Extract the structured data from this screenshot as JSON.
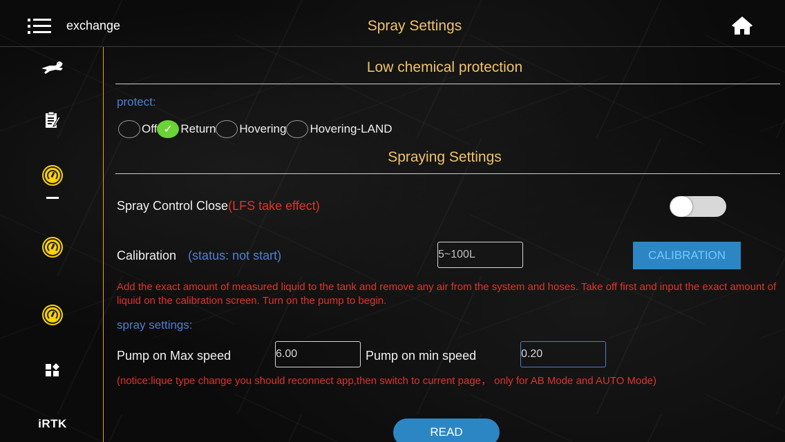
{
  "topbar": {
    "menu_icon": "menu-icon",
    "exchange_label": "exchange",
    "title": "Spray Settings",
    "home_icon": "home-icon"
  },
  "sidebar": {
    "items": [
      {
        "icon": "plane-wrench-icon"
      },
      {
        "icon": "clipboard-edit-icon"
      },
      {
        "icon": "gauge-icon"
      },
      {
        "icon": "dash-icon"
      },
      {
        "icon": "gauge-icon"
      },
      {
        "icon": "gauge-icon"
      },
      {
        "icon": "grid-apps-icon"
      },
      {
        "label": "iRTK"
      }
    ]
  },
  "low_chemical": {
    "heading": "Low chemical protection",
    "protect_label": "protect:",
    "options": [
      "Off",
      "Return",
      "Hovering",
      "Hovering-LAND"
    ],
    "selected": "Return"
  },
  "spraying": {
    "heading": "Spraying Settings",
    "spray_control_label": "Spray Control Close",
    "spray_control_note": "(LFS take effect)",
    "spray_control_on": false,
    "calibration_label": "Calibration",
    "calibration_status": "(status: not start)",
    "calibration_placeholder": "5~100L",
    "calibration_button": "CALIBRATION",
    "calibration_help": "Add the exact amount of measured liquid to the tank and remove any air from the system and hoses. Take off first and input the exact amount of liquid on the calibration screen. Turn on the pump to begin.",
    "spray_settings_label": "spray settings:",
    "pump_max_label": "Pump on Max speed",
    "pump_max_value": "6.00",
    "pump_min_label": "Pump on min speed",
    "pump_min_value": "0.20",
    "notice": "(notice:lique type change you should reconnect app,then switch to current page， only for AB Mode and AUTO Mode)",
    "read_button": "READ"
  },
  "colors": {
    "accent_gold": "#f0c36a",
    "active_green": "#6ad336",
    "warning_red": "#e4322b",
    "info_blue": "#4f7fd1",
    "button_blue": "#2c86c4"
  }
}
